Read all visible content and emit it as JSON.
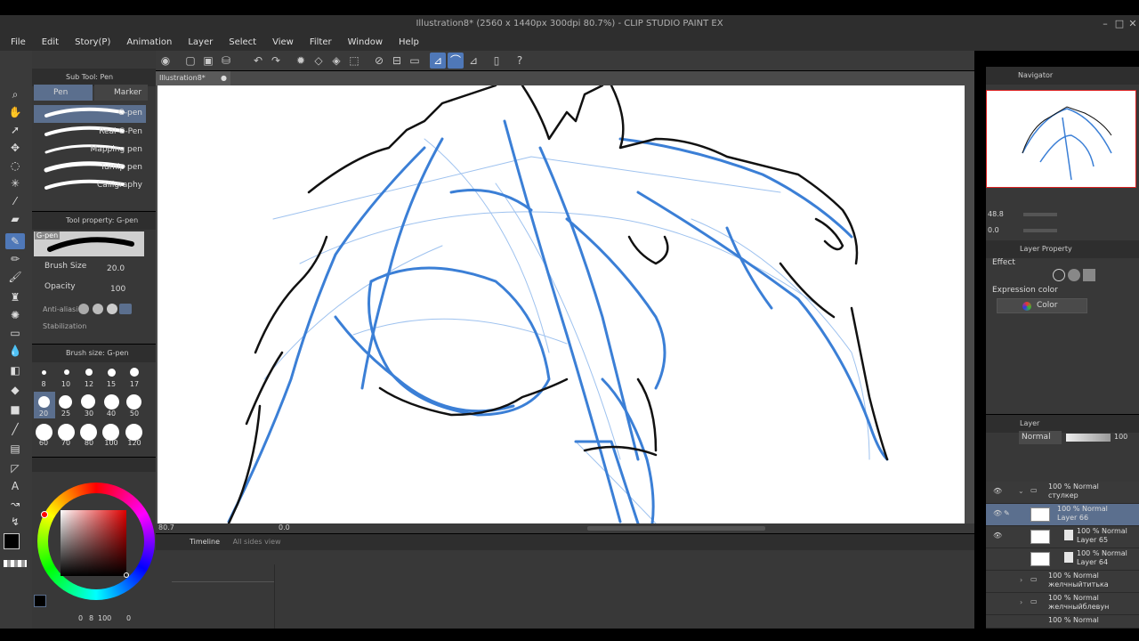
{
  "title_bar": {
    "text": "Illustration8* (2560 x 1440px 300dpi 80.7%) - CLIP STUDIO PAINT EX"
  },
  "window_controls": {
    "minimize": "–",
    "maximize": "□",
    "close": "✕"
  },
  "menu": [
    "File",
    "Edit",
    "Story(P)",
    "Animation",
    "Layer",
    "Select",
    "View",
    "Filter",
    "Window",
    "Help"
  ],
  "document_tab": {
    "label": "Illustration8*"
  },
  "sub_tool": {
    "header": "Sub Tool: Pen",
    "tabs": [
      "Pen",
      "Marker"
    ],
    "brushes": [
      "G-pen",
      "Real G-Pen",
      "Mapping pen",
      "Turnip pen",
      "Calligraphy"
    ],
    "selected_brush": "G-pen"
  },
  "tool_property": {
    "header": "Tool property: G-pen",
    "brush_name": "G-pen",
    "brush_size_label": "Brush Size",
    "brush_size_value": "20.0",
    "opacity_label": "Opacity",
    "opacity_value": "100",
    "anti_alias_label": "Anti-aliasi",
    "stabilization_label": "Stabilization"
  },
  "brush_size_panel": {
    "header": "Brush size: G-pen",
    "sizes_row1": [
      "8",
      "10",
      "12",
      "15",
      "17"
    ],
    "sizes_row2": [
      "20",
      "25",
      "30",
      "40",
      "50"
    ],
    "sizes_row3": [
      "60",
      "70",
      "80",
      "100",
      "120"
    ],
    "selected_size": "20"
  },
  "color_panel": {
    "main_color": "#000000",
    "sub_color": "#f0e000",
    "bottom_values": [
      "0",
      "8",
      "100",
      "0"
    ]
  },
  "canvas_status": {
    "zoom": "80.7",
    "angle": "0.0"
  },
  "timeline": {
    "tab": "Timeline",
    "tab2": "All sides view"
  },
  "navigator": {
    "header": "Navigator",
    "zoom": "48.8",
    "angle": "0.0"
  },
  "layer_property": {
    "header": "Layer Property",
    "effect_label": "Effect",
    "expression_label": "Expression color",
    "expression_value": "Color"
  },
  "layer_panel": {
    "header": "Layer",
    "blend_mode": "Normal",
    "opacity": "100",
    "layers": [
      {
        "mode": "100 % Normal",
        "name": "стулкер",
        "type": "folder"
      },
      {
        "mode": "100 % Normal",
        "name": "Layer 66",
        "type": "raster",
        "selected": true
      },
      {
        "mode": "100 % Normal",
        "name": "Layer 65",
        "type": "raster"
      },
      {
        "mode": "100 % Normal",
        "name": "Layer 64",
        "type": "raster"
      },
      {
        "mode": "100 % Normal",
        "name": "желчныйтитька",
        "type": "folder"
      },
      {
        "mode": "100 % Normal",
        "name": "желчныйблевун",
        "type": "folder"
      },
      {
        "mode": "100 % Normal",
        "name": "",
        "type": "folder"
      }
    ]
  },
  "colors": {
    "accent": "#4f78b8",
    "sketch_blue": "#3b7fd6",
    "panel_bg": "#383838"
  }
}
